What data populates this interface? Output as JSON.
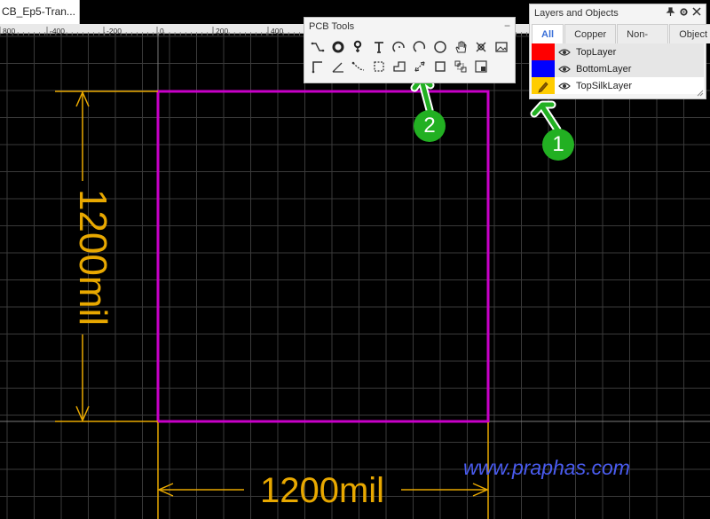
{
  "document_tab": {
    "label": "CB_Ep5-Tran..."
  },
  "ruler": {
    "labels": [
      "800",
      "-400",
      "-200",
      "0",
      "200",
      "400"
    ]
  },
  "dimensions": {
    "vertical_label": "1200mil",
    "horizontal_label": "1200mil"
  },
  "pcb_tools": {
    "title": "PCB Tools",
    "minimize": "−",
    "tools": [
      {
        "icon": "track-icon"
      },
      {
        "icon": "pad-icon"
      },
      {
        "icon": "via-icon"
      },
      {
        "icon": "text-icon"
      },
      {
        "icon": "arc-icon"
      },
      {
        "icon": "arc-center-icon"
      },
      {
        "icon": "circle-icon"
      },
      {
        "icon": "pan-hand-icon"
      },
      {
        "icon": "connect-pad-icon"
      },
      {
        "icon": "image-icon"
      },
      {
        "icon": "corner-icon"
      },
      {
        "icon": "angle-icon"
      },
      {
        "icon": "polyline-icon"
      },
      {
        "icon": "dashed-rect-icon"
      },
      {
        "icon": "board-outline-icon"
      },
      {
        "icon": "dimension-icon"
      },
      {
        "icon": "rect-icon"
      },
      {
        "icon": "group-icon"
      },
      {
        "icon": "layout-icon"
      }
    ]
  },
  "layers_panel": {
    "title": "Layers and Objects",
    "tabs": [
      "All",
      "Copper",
      "Non-Copper",
      "Object"
    ],
    "active_tab": "All",
    "layers": [
      {
        "name": "TopLayer",
        "color": "#ff0000"
      },
      {
        "name": "BottomLayer",
        "color": "#0000ff"
      },
      {
        "name": "TopSilkLayer",
        "color": "#ffcc00"
      }
    ]
  },
  "annotations": {
    "badge1": "1",
    "badge2": "2"
  },
  "watermark": "www.praphas.com",
  "colors": {
    "grid": "#3a3a3a",
    "board_outline": "#c800c8",
    "dimension": "#e8a800",
    "arrow_green": "#22b022",
    "accent_tab": "#3a6fd8"
  }
}
